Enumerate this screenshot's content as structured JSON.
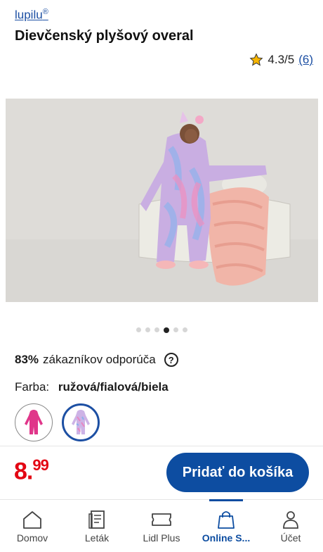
{
  "product": {
    "brand": "lupilu",
    "brand_mark": "®",
    "title": "Dievčenský plyšový overal",
    "rating": "4.3/5",
    "rating_count": "(6)"
  },
  "gallery": {
    "image_alt": "Dievčenský plyšový overal",
    "dot_count": 6,
    "active_dot": 3
  },
  "recommend": {
    "percent": "83%",
    "text": "zákazníkov odporúča",
    "help": "?"
  },
  "color": {
    "label": "Farba:",
    "value": "ružová/fialová/biela",
    "swatches": [
      {
        "name": "pink",
        "selected": false
      },
      {
        "name": "unicorn-pattern",
        "selected": true
      }
    ]
  },
  "purchase": {
    "price_main": "8.",
    "price_cents": "99",
    "cart_label": "Pridať do košíka"
  },
  "nav": [
    {
      "label": "Domov",
      "icon": "home-icon"
    },
    {
      "label": "Leták",
      "icon": "leaflet-icon"
    },
    {
      "label": "Lidl Plus",
      "icon": "lidl-plus-icon"
    },
    {
      "label": "Online S...",
      "icon": "shopping-bag-icon",
      "active": true
    },
    {
      "label": "Účet",
      "icon": "account-icon"
    }
  ],
  "colors": {
    "accent": "#0d4da1",
    "price": "#e30613",
    "link": "#1c4fa3"
  }
}
